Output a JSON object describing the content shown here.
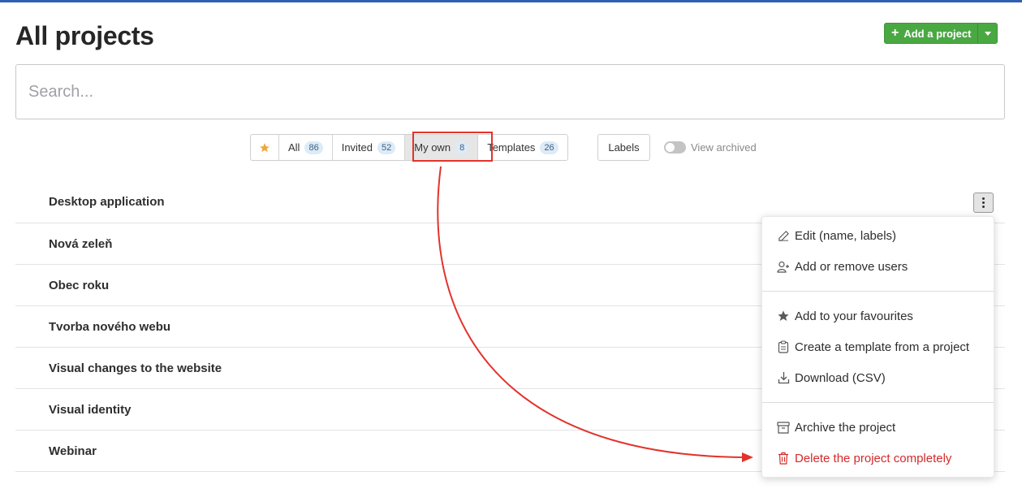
{
  "page": {
    "title": "All projects"
  },
  "header": {
    "add_label": "Add a project"
  },
  "search": {
    "placeholder": "Search..."
  },
  "filters": [
    {
      "label": "All",
      "count": "86"
    },
    {
      "label": "Invited",
      "count": "52"
    },
    {
      "label": "My own",
      "count": "8",
      "active": true
    },
    {
      "label": "Templates",
      "count": "26"
    }
  ],
  "labels_button": "Labels",
  "archived_toggle": {
    "label": "View archived",
    "on": false
  },
  "projects": [
    "Desktop application",
    "Nová zeleň",
    "Obec roku",
    "Tvorba nového webu",
    "Visual changes to the website",
    "Visual identity",
    "Webinar"
  ],
  "context_menu": {
    "items": [
      {
        "label": "Edit (name, labels)",
        "icon": "pencil-icon"
      },
      {
        "label": "Add or remove users",
        "icon": "user-plus-icon"
      },
      {
        "label": "Add to your favourites",
        "icon": "star-icon"
      },
      {
        "label": "Create a template from a project",
        "icon": "clipboard-icon"
      },
      {
        "label": "Download (CSV)",
        "icon": "download-icon"
      },
      {
        "label": "Archive the project",
        "icon": "archive-icon"
      },
      {
        "label": "Delete the project completely",
        "icon": "trash-icon",
        "danger": true
      }
    ]
  },
  "colors": {
    "accent_green": "#4aa843",
    "top_bar": "#2f5fb3",
    "highlight_red": "#e2332b",
    "danger": "#d42a2a",
    "favourite_star": "#f0a63a"
  }
}
